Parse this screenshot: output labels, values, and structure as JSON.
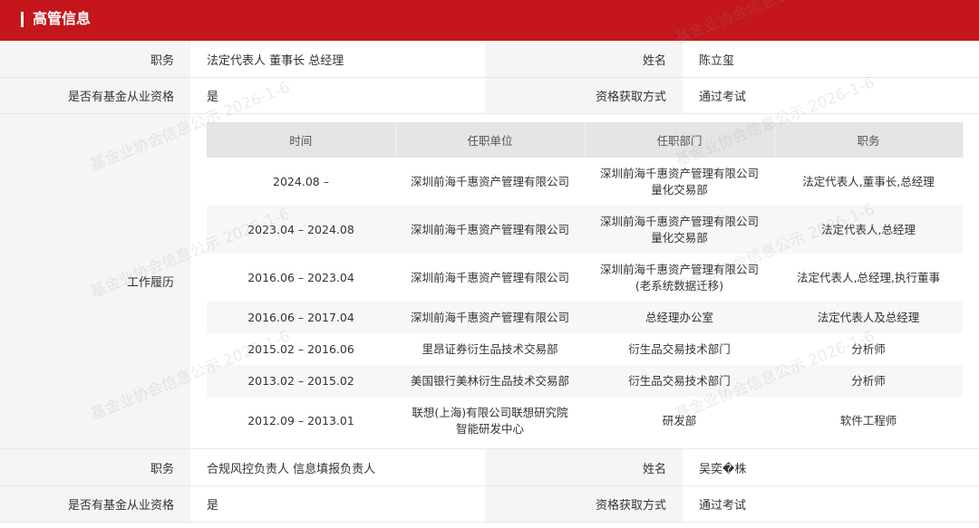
{
  "header": {
    "title": "高管信息"
  },
  "person1": {
    "position_label": "职务",
    "position_value": "法定代表人 董事长 总经理",
    "name_label": "姓名",
    "name_value": "陈立玺",
    "qualification_label": "是否有基金从业资格",
    "qualification_value": "是",
    "method_label": "资格获取方式",
    "method_value": "通过考试"
  },
  "experience": {
    "label": "工作履历",
    "columns": [
      "时间",
      "任职单位",
      "任职部门",
      "职务"
    ],
    "rows": [
      [
        "2024.08 –",
        "深圳前海千惠资产管理有限公司",
        "深圳前海千惠资产管理有限公司量化交易部",
        "法定代表人,董事长,总经理"
      ],
      [
        "2023.04 – 2024.08",
        "深圳前海千惠资产管理有限公司",
        "深圳前海千惠资产管理有限公司量化交易部",
        "法定代表人,总经理"
      ],
      [
        "2016.06 – 2023.04",
        "深圳前海千惠资产管理有限公司",
        "深圳前海千惠资产管理有限公司(老系统数据迁移)",
        "法定代表人,总经理,执行董事"
      ],
      [
        "2016.06 – 2017.04",
        "深圳前海千惠资产管理有限公司",
        "总经理办公室",
        "法定代表人及总经理"
      ],
      [
        "2015.02 – 2016.06",
        "里昂证券衍生品技术交易部",
        "衍生品交易技术部门",
        "分析师"
      ],
      [
        "2013.02 – 2015.02",
        "美国银行美林衍生品技术交易部",
        "衍生品交易技术部门",
        "分析师"
      ],
      [
        "2012.09 – 2013.01",
        "联想(上海)有限公司联想研究院智能研发中心",
        "研发部",
        "软件工程师"
      ]
    ]
  },
  "person2": {
    "position_label": "职务",
    "position_value": "合规风控负责人 信息填报负责人",
    "name_label": "姓名",
    "name_value": "吴奕�株",
    "qualification_label": "是否有基金从业资格",
    "qualification_value": "是",
    "method_label": "资格获取方式",
    "method_value": "通过考试"
  },
  "watermark": {
    "text": "基金业协会信息公示 2026-1-6"
  },
  "colors": {
    "header_bg": "#c4161c",
    "label_bg": "#f5f5f5",
    "table_header_bg": "#e5e5e5"
  }
}
